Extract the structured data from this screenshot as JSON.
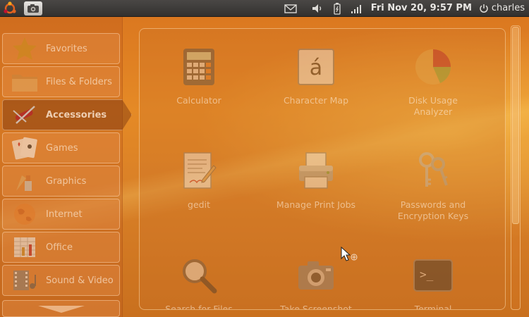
{
  "panel": {
    "clock": "Fri Nov 20,  9:57 PM",
    "user": "charles",
    "icons": [
      "ubuntu-logo-icon",
      "camera-icon",
      "mail-icon",
      "volume-icon",
      "battery-icon",
      "signal-icon",
      "power-icon"
    ]
  },
  "sidebar": {
    "items": [
      {
        "label": "Favorites",
        "icon": "star-icon"
      },
      {
        "label": "Files & Folders",
        "icon": "folder-icon"
      },
      {
        "label": "Accessories",
        "icon": "swiss-knife-icon",
        "active": true
      },
      {
        "label": "Games",
        "icon": "playing-cards-icon"
      },
      {
        "label": "Graphics",
        "icon": "paint-icon"
      },
      {
        "label": "Internet",
        "icon": "globe-icon"
      },
      {
        "label": "Office",
        "icon": "spreadsheet-icon"
      },
      {
        "label": "Sound & Video",
        "icon": "film-icon"
      }
    ],
    "scroll_icon": "chevron-down-icon"
  },
  "apps": [
    {
      "label": "Calculator",
      "icon": "calculator-icon"
    },
    {
      "label": "Character Map",
      "icon": "character-map-icon"
    },
    {
      "label": "Disk Usage Analyzer",
      "icon": "pie-chart-icon"
    },
    {
      "label": "gedit",
      "icon": "text-editor-icon"
    },
    {
      "label": "Manage Print Jobs",
      "icon": "printer-icon"
    },
    {
      "label": "Passwords and Encryption Keys",
      "icon": "keys-icon"
    },
    {
      "label": "Search for Files",
      "icon": "magnifier-icon"
    },
    {
      "label": "Take Screenshot",
      "icon": "camera-icon"
    },
    {
      "label": "Terminal",
      "icon": "terminal-icon"
    }
  ],
  "glyphs": {
    "char_map": "á",
    "terminal": ">_"
  },
  "colors": {
    "panel_bg": "#3a3836",
    "desktop_orange": "#e58a26",
    "text_light": "#fff0e1"
  }
}
